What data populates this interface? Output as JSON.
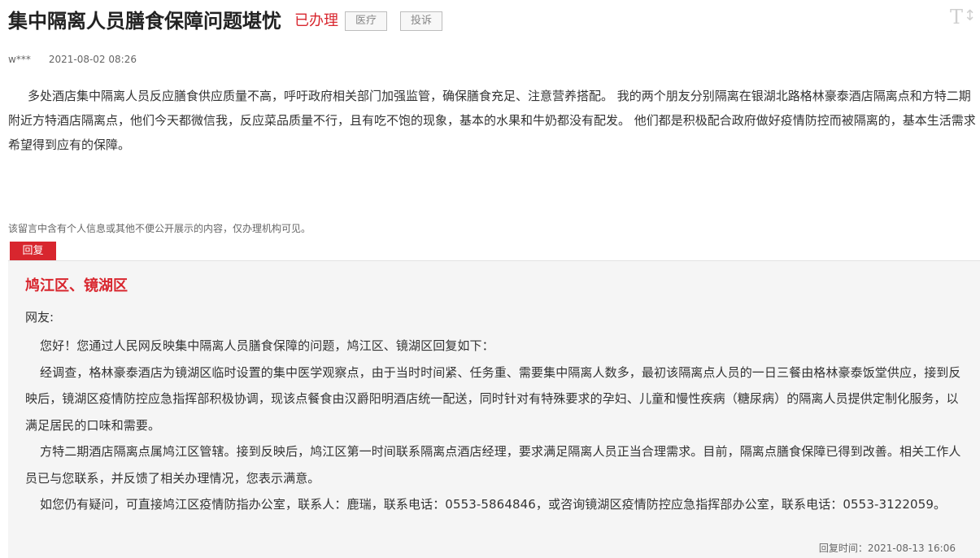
{
  "header": {
    "title": "集中隔离人员膳食保障问题堪忧",
    "status": "已办理",
    "tags": [
      "医疗",
      "投诉"
    ]
  },
  "font_toggle": {
    "label": "T",
    "arrow": "↕",
    "icon": "font-size-icon"
  },
  "meta": {
    "user": "w***",
    "datetime": "2021-08-02 08:26"
  },
  "message": {
    "content": "多处酒店集中隔离人员反应膳食供应质量不高，呼吁政府相关部门加强监管，确保膳食充足、注意营养搭配。       我的两个朋友分别隔离在银湖北路格林豪泰酒店隔离点和方特二期附近方特酒店隔离点，他们今天都微信我，反应菜品质量不行，且有吃不饱的现象，基本的水果和牛奶都没有配发。       他们都是积极配合政府做好疫情防控而被隔离的，基本生活需求希望得到应有的保障。"
  },
  "privacy_note": "该留言中含有个人信息或其他不便公开展示的内容，仅办理机构可见。",
  "reply": {
    "tab_label": "回复",
    "org": "鸠江区、镜湖区",
    "greeting": "网友:",
    "paragraphs": [
      "您好！您通过人民网反映集中隔离人员膳食保障的问题，鸠江区、镜湖区回复如下：",
      "经调查，格林豪泰酒店为镜湖区临时设置的集中医学观察点，由于当时时间紧、任务重、需要集中隔离人数多，最初该隔离点人员的一日三餐由格林豪泰饭堂供应，接到反映后，镜湖区疫情防控应急指挥部积极协调，现该点餐食由汉爵阳明酒店统一配送，同时针对有特殊要求的孕妇、儿童和慢性疾病（糖尿病）的隔离人员提供定制化服务，以满足居民的口味和需要。",
      "方特二期酒店隔离点属鸠江区管辖。接到反映后，鸠江区第一时间联系隔离点酒店经理，要求满足隔离人员正当合理需求。目前，隔离点膳食保障已得到改善。相关工作人员已与您联系，并反馈了相关办理情况，您表示满意。",
      "如您仍有疑问，可直接鸠江区疫情防指办公室，联系人：鹿瑞，联系电话：0553-5864846，或咨询镜湖区疫情防控应急指挥部办公室，联系电话：0553-3122059。"
    ],
    "time": "回复时间：2021-08-13 16:06"
  },
  "colors": {
    "accent_red": "#d8262e",
    "reply_bg": "#f5f5f5"
  }
}
